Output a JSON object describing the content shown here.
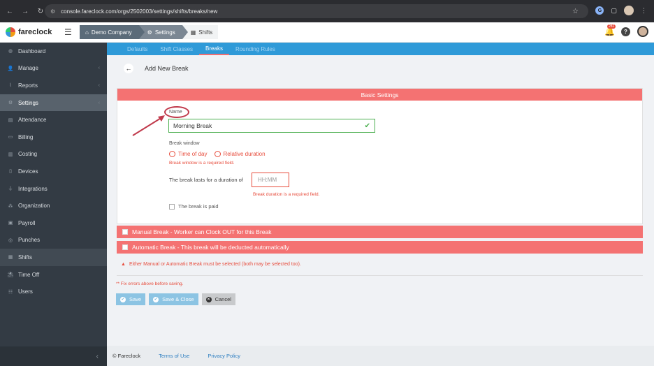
{
  "browser": {
    "url": "console.fareclock.com/orgs/2502003/settings/shifts/breaks/new",
    "notifications": "281"
  },
  "app": {
    "brand": "fareclock",
    "breadcrumbs": [
      "Demo Company",
      "Settings",
      "Shifts"
    ]
  },
  "sidebar": {
    "items": [
      {
        "label": "Dashboard",
        "icon": "dashboard-icon"
      },
      {
        "label": "Manage",
        "icon": "person-icon",
        "chevron": true
      },
      {
        "label": "Reports",
        "icon": "chart-icon",
        "chevron": true
      },
      {
        "label": "Settings",
        "icon": "gear-icon",
        "chevron": true
      },
      {
        "label": "Attendance",
        "icon": "calendar-icon"
      },
      {
        "label": "Billing",
        "icon": "card-icon"
      },
      {
        "label": "Costing",
        "icon": "bar-chart-icon"
      },
      {
        "label": "Devices",
        "icon": "tablet-icon"
      },
      {
        "label": "Integrations",
        "icon": "plug-icon"
      },
      {
        "label": "Organization",
        "icon": "org-icon"
      },
      {
        "label": "Payroll",
        "icon": "money-icon"
      },
      {
        "label": "Punches",
        "icon": "punch-icon"
      },
      {
        "label": "Shifts",
        "icon": "shifts-icon"
      },
      {
        "label": "Time Off",
        "icon": "beach-icon"
      },
      {
        "label": "Users",
        "icon": "users-icon"
      }
    ]
  },
  "tabs": [
    "Defaults",
    "Shift Classes",
    "Breaks",
    "Rounding Rules"
  ],
  "page": {
    "title": "Add New Break",
    "section_title": "Basic Settings",
    "name_label": "Name",
    "name_value": "Morning Break",
    "break_window_label": "Break window",
    "radio_time_of_day": "Time of day",
    "radio_relative": "Relative duration",
    "break_window_error": "Break window is a required field.",
    "duration_label": "The break lasts for a duration of",
    "duration_placeholder": "HH:MM",
    "duration_error": "Break duration is a required field.",
    "paid_label": "The break is paid",
    "manual_break": "Manual Break - Worker can Clock OUT for this Break",
    "automatic_break": "Automatic Break - This break will be deducted automatically",
    "either_warning": "Either Manual or Automatic Break must be selected (both may be selected too).",
    "fix_errors": "** Fix errors above before saving.",
    "save": "Save",
    "save_close": "Save & Close",
    "cancel": "Cancel"
  },
  "footer": {
    "copyright": "© Fareclock",
    "terms": "Terms of Use",
    "privacy": "Privacy Policy"
  },
  "colors": {
    "sidebar": "#333b44",
    "tab_bar": "#2f9ad8",
    "section_header": "#f47272",
    "error": "#e74c3c",
    "valid": "#4caf50"
  }
}
